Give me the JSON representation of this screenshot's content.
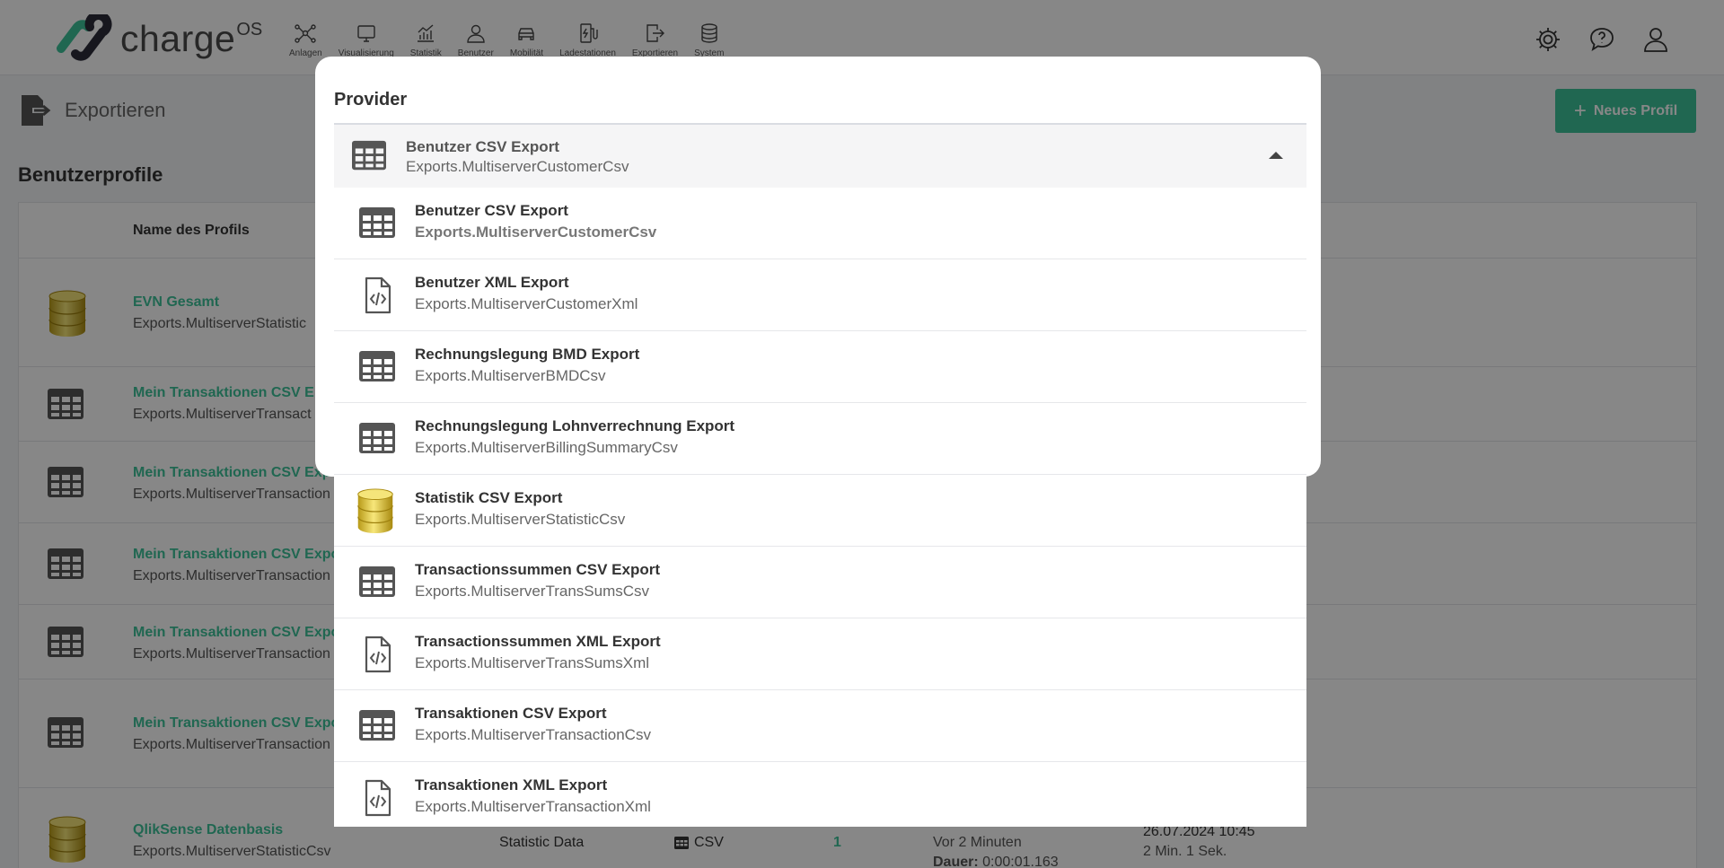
{
  "brand": {
    "name": "charge",
    "suffix": "OS",
    "accent": "#3ec29a"
  },
  "nav": [
    {
      "label": "Anlagen",
      "icon": "network-icon"
    },
    {
      "label": "Visualisierung",
      "icon": "monitor-icon"
    },
    {
      "label": "Statistik",
      "icon": "chart-icon"
    },
    {
      "label": "Benutzer",
      "icon": "user-icon"
    },
    {
      "label": "Mobilität",
      "icon": "car-icon"
    },
    {
      "label": "Ladestationen",
      "icon": "charger-icon"
    },
    {
      "label": "Exportieren",
      "icon": "export-icon"
    },
    {
      "label": "System",
      "icon": "database-icon"
    }
  ],
  "header": {
    "settings_icon": "gear-icon",
    "help_icon": "chat-help-icon",
    "account_icon": "user-icon"
  },
  "page": {
    "title": "Exportieren",
    "new_profile_label": "Neues Profil",
    "section_title": "Benutzerprofile",
    "table_header_name": "Name des Profils",
    "rows": [
      {
        "name": "EVN Gesamt",
        "sub": "Exports.MultiserverStatistic",
        "icon": "database-icon"
      },
      {
        "name": "Mein Transaktionen CSV E",
        "sub": "Exports.MultiserverTransact",
        "icon": "table-icon"
      },
      {
        "name": "Mein Transaktionen CSV Exp",
        "sub": "Exports.MultiserverTransaction",
        "icon": "table-icon"
      },
      {
        "name": "Mein Transaktionen CSV Expo",
        "sub": "Exports.MultiserverTransaction",
        "icon": "table-icon"
      },
      {
        "name": "Mein Transaktionen CSV Expo",
        "sub": "Exports.MultiserverTransaction",
        "icon": "table-icon"
      },
      {
        "name": "Mein Transaktionen CSV Expo",
        "sub": "Exports.MultiserverTransaction",
        "icon": "table-icon"
      },
      {
        "name": "QlikSense Datenbasis",
        "sub": "Exports.MultiserverStatisticCsv",
        "icon": "database-icon",
        "type": "Statistic Data",
        "format": "CSV",
        "count": "1",
        "last_run": "Vor 2 Minuten",
        "duration_label": "Dauer:",
        "duration": "0:00:01.163",
        "date": "26.07.2024 10:45",
        "interval": "2 Min. 1 Sek."
      }
    ]
  },
  "modal": {
    "label": "Provider",
    "selected": {
      "title": "Benutzer CSV Export",
      "sub": "Exports.MultiserverCustomerCsv",
      "icon": "table-icon"
    },
    "options": [
      {
        "title": "Benutzer CSV Export",
        "sub": "Exports.MultiserverCustomerCsv",
        "icon": "table-icon"
      },
      {
        "title": "Benutzer XML Export",
        "sub": "Exports.MultiserverCustomerXml",
        "icon": "xml-file-icon"
      },
      {
        "title": "Rechnungslegung BMD Export",
        "sub": "Exports.MultiserverBMDCsv",
        "icon": "table-icon"
      },
      {
        "title": "Rechnungslegung Lohnverrechnung Export",
        "sub": "Exports.MultiserverBillingSummaryCsv",
        "icon": "table-icon"
      },
      {
        "title": "Statistik CSV Export",
        "sub": "Exports.MultiserverStatisticCsv",
        "icon": "database-icon"
      },
      {
        "title": "Transactionssummen CSV Export",
        "sub": "Exports.MultiserverTransSumsCsv",
        "icon": "table-icon"
      },
      {
        "title": "Transactionssummen XML Export",
        "sub": "Exports.MultiserverTransSumsXml",
        "icon": "xml-file-icon"
      },
      {
        "title": "Transaktionen CSV Export",
        "sub": "Exports.MultiserverTransactionCsv",
        "icon": "table-icon"
      },
      {
        "title": "Transaktionen XML Export",
        "sub": "Exports.MultiserverTransactionXml",
        "icon": "xml-file-icon"
      }
    ]
  }
}
